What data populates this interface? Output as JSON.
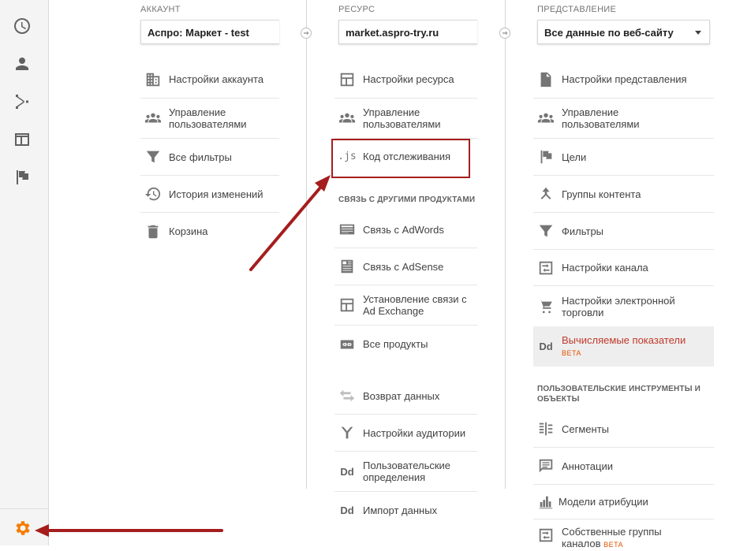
{
  "sidebar": {
    "items": [
      {
        "icon": "clock-icon"
      },
      {
        "icon": "person-icon"
      },
      {
        "icon": "share-icon"
      },
      {
        "icon": "browser-window-icon"
      },
      {
        "icon": "flag-icon"
      }
    ],
    "settings_icon": "gear-icon"
  },
  "account": {
    "heading": "Аккаунт",
    "selected": "Аспро: Маркет - test",
    "items": [
      {
        "icon": "building-icon",
        "label": "Настройки аккаунта"
      },
      {
        "icon": "people-icon",
        "label": "Управление пользователями"
      },
      {
        "icon": "filter-icon",
        "label": "Все фильтры"
      },
      {
        "icon": "history-icon",
        "label": "История изменений"
      },
      {
        "icon": "trash-icon",
        "label": "Корзина"
      }
    ]
  },
  "property": {
    "heading": "Ресурс",
    "selected": "market.aspro-try.ru",
    "items": [
      {
        "icon": "property-icon",
        "label": "Настройки ресурса"
      },
      {
        "icon": "people-icon",
        "label": "Управление пользователями"
      },
      {
        "icon": "js-icon",
        "icon_text": ".js",
        "label": "Код отслеживания"
      }
    ],
    "section": "Связь с другими продуктами",
    "product_items": [
      {
        "icon": "adwords-icon",
        "label": "Связь с AdWords"
      },
      {
        "icon": "adsense-icon",
        "label": "Связь с AdSense"
      },
      {
        "icon": "exchange-icon",
        "label": "Установление связи с Ad Exchange"
      },
      {
        "icon": "link-icon",
        "label": "Все продукты"
      }
    ],
    "more_items": [
      {
        "icon": "data-return-icon",
        "label": "Возврат данных"
      },
      {
        "icon": "audience-icon",
        "label": "Настройки аудитории"
      },
      {
        "icon": "dd-icon",
        "icon_text": "Dd",
        "label": "Пользовательские определения"
      },
      {
        "icon": "dd-icon",
        "icon_text": "Dd",
        "label": "Импорт данных"
      }
    ]
  },
  "view": {
    "heading": "Представление",
    "selected": "Все данные по веб-сайту",
    "items": [
      {
        "icon": "document-icon",
        "label": "Настройки представления"
      },
      {
        "icon": "people-icon",
        "label": "Управление пользователями"
      },
      {
        "icon": "flag-icon",
        "label": "Цели"
      },
      {
        "icon": "content-groups-icon",
        "label": "Группы контента"
      },
      {
        "icon": "filter-icon",
        "label": "Фильтры"
      },
      {
        "icon": "channel-settings-icon",
        "label": "Настройки канала"
      },
      {
        "icon": "cart-icon",
        "label": "Настройки электронной торговли"
      },
      {
        "icon": "dd-icon",
        "icon_text": "Dd",
        "label": "Вычисляемые показатели",
        "badge": "BETA"
      }
    ],
    "section": "Пользовательские инструменты и объекты",
    "tool_items": [
      {
        "icon": "segments-icon",
        "label": "Сегменты"
      },
      {
        "icon": "annotation-icon",
        "label": "Аннотации"
      },
      {
        "icon": "attribution-icon",
        "label": "Модели атрибуции"
      },
      {
        "icon": "channel-settings-icon",
        "label": "Собственные группы каналов",
        "badge": "BETA"
      }
    ]
  },
  "colors": {
    "accent": "#f57c00",
    "highlight": "#a51d1d",
    "active_text": "#c0392b"
  }
}
